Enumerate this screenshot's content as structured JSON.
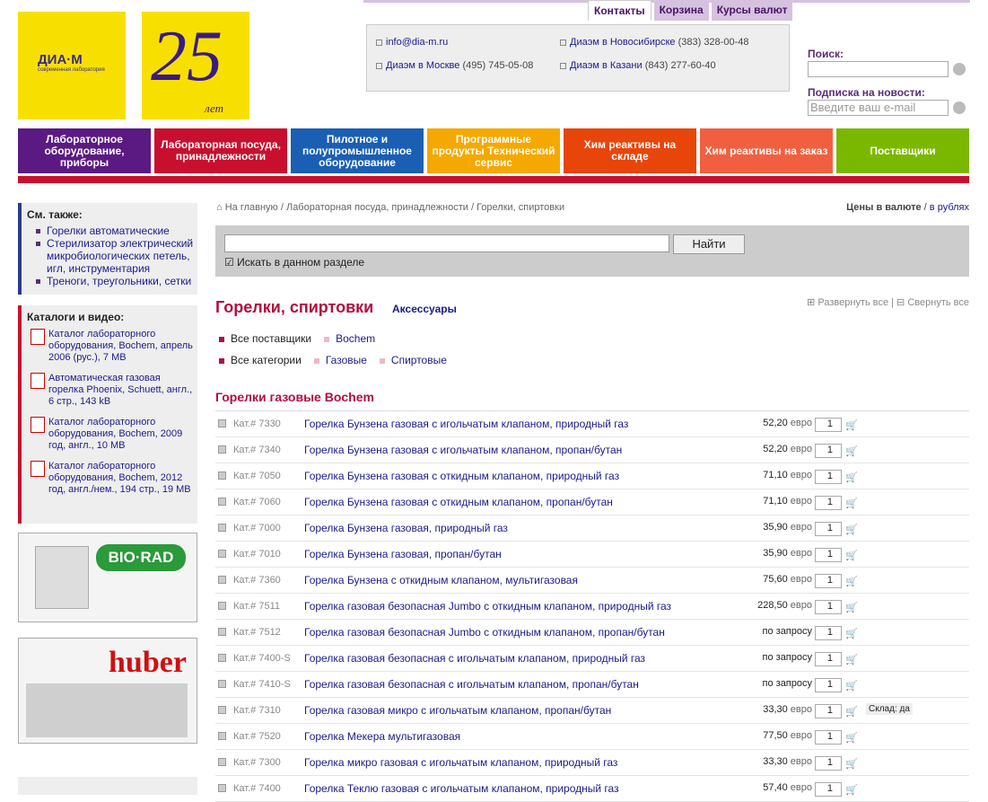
{
  "logos": {
    "diam": "ДИА·М",
    "diam_sub": "современная лаборатория",
    "years": "25",
    "years_sub": "лет"
  },
  "tabs": [
    "Контакты",
    "Корзина",
    "Курсы валют"
  ],
  "contacts": {
    "email": "info@dia-m.ru",
    "moscow": "Диаэм в Москве",
    "moscow_phone": "(495) 745-05-08",
    "nsk": "Диаэм в Новосибирске",
    "nsk_phone": "(383) 328-00-48",
    "kazan": "Диаэм в Казани",
    "kazan_phone": "(843) 277-60-40"
  },
  "search_label": "Поиск:",
  "subscribe_label": "Подписка на новости:",
  "subscribe_placeholder": "Введите ваш e-mail",
  "menu": [
    {
      "label": "Лабораторное оборудование, приборы",
      "color": "#5b1a82"
    },
    {
      "label": "Лабораторная посуда, принадлежности",
      "color": "#c8102e"
    },
    {
      "label": "Пилотное и полупромышленное оборудование",
      "color": "#1a5fb4"
    },
    {
      "label": "Программные продукты Технический сервис",
      "color": "#f5a800"
    },
    {
      "label": "Хим реактивы на складе",
      "color": "#e8450a"
    },
    {
      "label": "Хим реактивы на заказ",
      "color": "#f06040"
    },
    {
      "label": "Поставщики",
      "color": "#7ab800"
    }
  ],
  "see_also": {
    "title": "См. также:",
    "items": [
      "Горелки автоматические",
      "Стерилизатор электрический микробиологических петель, игл, инструментария",
      "Треноги, треугольники, сетки"
    ]
  },
  "catalogs": {
    "title": "Каталоги и видео:",
    "items": [
      "Каталог лабораторного оборудования, Bochem, апрель 2006 (рус.), 7 MB",
      "Автоматическая газовая горелка Phoenix, Schuett, англ., 6 стр., 143 kB",
      "Каталог лабораторного оборудования, Bochem, 2009 год, англ., 10 MB",
      "Каталог лабораторного оборудования, Bochem, 2012 год, англ./нем., 194 стр., 19 MB"
    ]
  },
  "banners": {
    "biorad": "BIO·RAD",
    "huber": "huber"
  },
  "breadcrumb": {
    "home": "На главную",
    "section": "Лабораторная посуда, принадлежности",
    "current": "Горелки, спиртовки"
  },
  "currency": {
    "label": "Цены в валюте",
    "alt": "в рублях"
  },
  "search": {
    "button": "Найти",
    "checkbox": "Искать в данном разделе"
  },
  "page_title": "Горелки, спиртовки",
  "accessories": "Аксессуары",
  "expand_all": "Развернуть все",
  "collapse_all": "Свернуть все",
  "suppliers": [
    "Все поставщики",
    "Bochem"
  ],
  "categories": [
    "Все категории",
    "Газовые",
    "Спиртовые"
  ],
  "group_title": "Горелки газовые Bochem",
  "products": [
    {
      "code": "Кат.# 7330",
      "name": "Горелка Бунзена газовая с игольчатым клапаном, природный газ",
      "price": "52,20",
      "cur": "евро",
      "qty": "1"
    },
    {
      "code": "Кат.# 7340",
      "name": "Горелка Бунзена газовая с игольчатым клапаном, пропан/бутан",
      "price": "52,20",
      "cur": "евро",
      "qty": "1"
    },
    {
      "code": "Кат.# 7050",
      "name": "Горелка Бунзена газовая с откидным клапаном, природный газ",
      "price": "71,10",
      "cur": "евро",
      "qty": "1"
    },
    {
      "code": "Кат.# 7060",
      "name": "Горелка Бунзена газовая с откидным клапаном, пропан/бутан",
      "price": "71,10",
      "cur": "евро",
      "qty": "1"
    },
    {
      "code": "Кат.# 7000",
      "name": "Горелка Бунзена газовая, природный газ",
      "price": "35,90",
      "cur": "евро",
      "qty": "1"
    },
    {
      "code": "Кат.# 7010",
      "name": "Горелка Бунзена газовая, пропан/бутан",
      "price": "35,90",
      "cur": "евро",
      "qty": "1"
    },
    {
      "code": "Кат.# 7360",
      "name": "Горелка Бунзена с откидным клапаном, мультигазовая",
      "price": "75,60",
      "cur": "евро",
      "qty": "1"
    },
    {
      "code": "Кат.# 7511",
      "name": "Горелка газовая безопасная Jumbo с откидным клапаном, природный газ",
      "price": "228,50",
      "cur": "евро",
      "qty": "1"
    },
    {
      "code": "Кат.# 7512",
      "name": "Горелка газовая безопасная Jumbo с откидным клапаном, пропан/бутан",
      "price": "по запросу",
      "cur": "",
      "qty": "1"
    },
    {
      "code": "Кат.# 7400-S",
      "name": "Горелка газовая безопасная с игольчатым клапаном, природный газ",
      "price": "по запросу",
      "cur": "",
      "qty": "1"
    },
    {
      "code": "Кат.# 7410-S",
      "name": "Горелка газовая безопасная с игольчатым клапаном, пропан/бутан",
      "price": "по запросу",
      "cur": "",
      "qty": "1"
    },
    {
      "code": "Кат.# 7310",
      "name": "Горелка газовая микро с игольчатым клапаном, пропан/бутан",
      "price": "33,30",
      "cur": "евро",
      "qty": "1",
      "stock": "Склад: да"
    },
    {
      "code": "Кат.# 7520",
      "name": "Горелка Мекера мультигазовая",
      "price": "77,50",
      "cur": "евро",
      "qty": "1"
    },
    {
      "code": "Кат.# 7300",
      "name": "Горелка микро газовая с игольчатым клапаном, природный газ",
      "price": "33,30",
      "cur": "евро",
      "qty": "1"
    },
    {
      "code": "Кат.# 7400",
      "name": "Горелка Теклю газовая с игольчатым клапаном, природный газ",
      "price": "57,40",
      "cur": "евро",
      "qty": "1"
    }
  ]
}
